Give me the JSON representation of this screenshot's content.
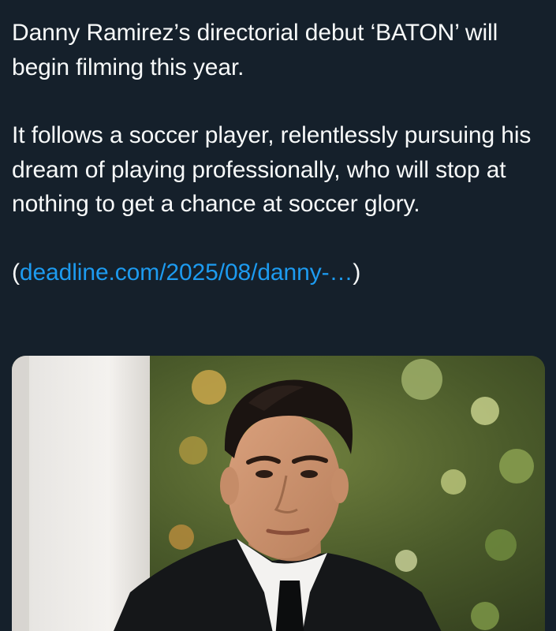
{
  "tweet": {
    "paragraph_1": "Danny Ramirez’s directorial debut ‘BATON’ will begin filming this year.",
    "paragraph_2": "It follows a soccer player, relentlessly pursuing his dream of playing professionally, who will stop at nothing to get a chance at soccer glory.",
    "link_open": "(",
    "link_text": "deadline.com/2025/08/danny-…",
    "link_close": ")"
  },
  "colors": {
    "background": "#15202b",
    "text": "#f7f9f9",
    "link": "#1d9bf0"
  },
  "media": {
    "type": "photo"
  }
}
